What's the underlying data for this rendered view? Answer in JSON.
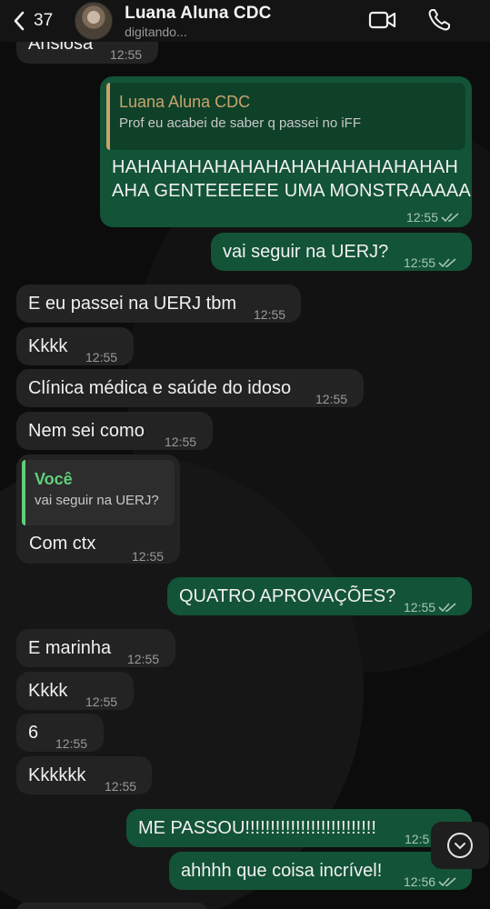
{
  "header": {
    "back_count": "37",
    "contact_name": "Luana Aluna CDC",
    "status": "digitando..."
  },
  "messages": [
    {
      "id": "m0",
      "dir": "in",
      "text": "Ansiosa",
      "time": "12:55"
    },
    {
      "id": "m1",
      "dir": "out",
      "quote_name": "Luana Aluna CDC",
      "quote_text": "Prof eu acabei de saber q passei no iFF",
      "text_line1": "HAHAHAHAHAHAHAHAHAHAHAHAHAH",
      "text_line2": "AHA GENTEEEEEE UMA MONSTRAAAAA",
      "time": "12:55"
    },
    {
      "id": "m2",
      "dir": "out",
      "text": "vai seguir na UERJ?",
      "time": "12:55"
    },
    {
      "id": "m3",
      "dir": "in",
      "text": "E eu passei na UERJ tbm",
      "time": "12:55"
    },
    {
      "id": "m4",
      "dir": "in",
      "text": "Kkkk",
      "time": "12:55"
    },
    {
      "id": "m5",
      "dir": "in",
      "text": "Clínica médica e saúde do idoso",
      "time": "12:55"
    },
    {
      "id": "m6",
      "dir": "in",
      "text": "Nem sei como",
      "time": "12:55"
    },
    {
      "id": "m7",
      "dir": "in",
      "quote_name": "Você",
      "quote_text": "vai seguir na UERJ?",
      "text": "Com ctx",
      "time": "12:55"
    },
    {
      "id": "m8",
      "dir": "out",
      "text": "QUATRO APROVAÇÕES?",
      "time": "12:55"
    },
    {
      "id": "m9",
      "dir": "in",
      "text": "E marinha",
      "time": "12:55"
    },
    {
      "id": "m10",
      "dir": "in",
      "text": "Kkkk",
      "time": "12:55"
    },
    {
      "id": "m11",
      "dir": "in",
      "text": "6",
      "time": "12:55"
    },
    {
      "id": "m12",
      "dir": "in",
      "text": "Kkkkkk",
      "time": "12:55"
    },
    {
      "id": "m13",
      "dir": "out",
      "text": "ME PASSOU!!!!!!!!!!!!!!!!!!!!!!!!!!",
      "time": "12:5"
    },
    {
      "id": "m14",
      "dir": "out",
      "text": "ahhhh que coisa incrível!",
      "time": "12:56"
    }
  ],
  "colors": {
    "incoming_bubble": "#232323",
    "outgoing_bubble": "#135337",
    "quote_name_contact": "#c9a46b",
    "quote_name_self": "#5fd07a"
  },
  "icons": {
    "back": "chevron-left-icon",
    "video": "video-camera-icon",
    "call": "phone-icon",
    "read": "double-check-icon",
    "scroll": "chevron-down-icon"
  }
}
